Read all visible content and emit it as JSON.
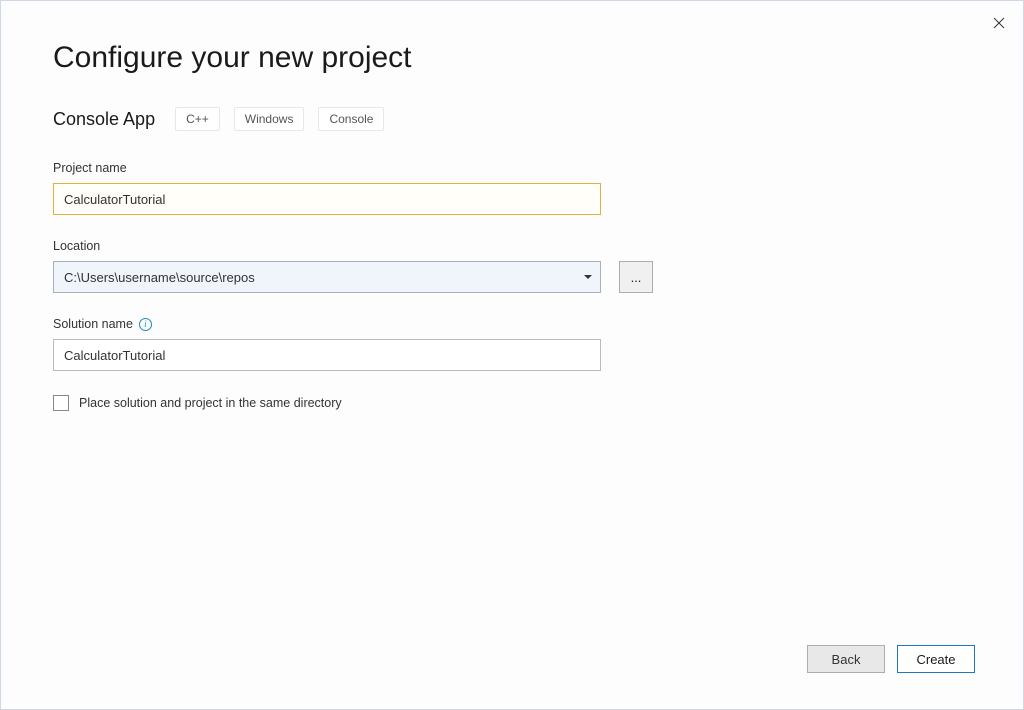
{
  "close_label": "✕",
  "page_title": "Configure your new project",
  "template": {
    "name": "Console App",
    "tags": [
      "C++",
      "Windows",
      "Console"
    ]
  },
  "fields": {
    "project_name": {
      "label": "Project name",
      "value": "CalculatorTutorial"
    },
    "location": {
      "label": "Location",
      "value": "C:\\Users\\username\\source\\repos",
      "browse_label": "..."
    },
    "solution_name": {
      "label": "Solution name",
      "value": "CalculatorTutorial"
    }
  },
  "checkbox": {
    "label": "Place solution and project in the same directory",
    "checked": false
  },
  "buttons": {
    "back": "Back",
    "create": "Create"
  }
}
